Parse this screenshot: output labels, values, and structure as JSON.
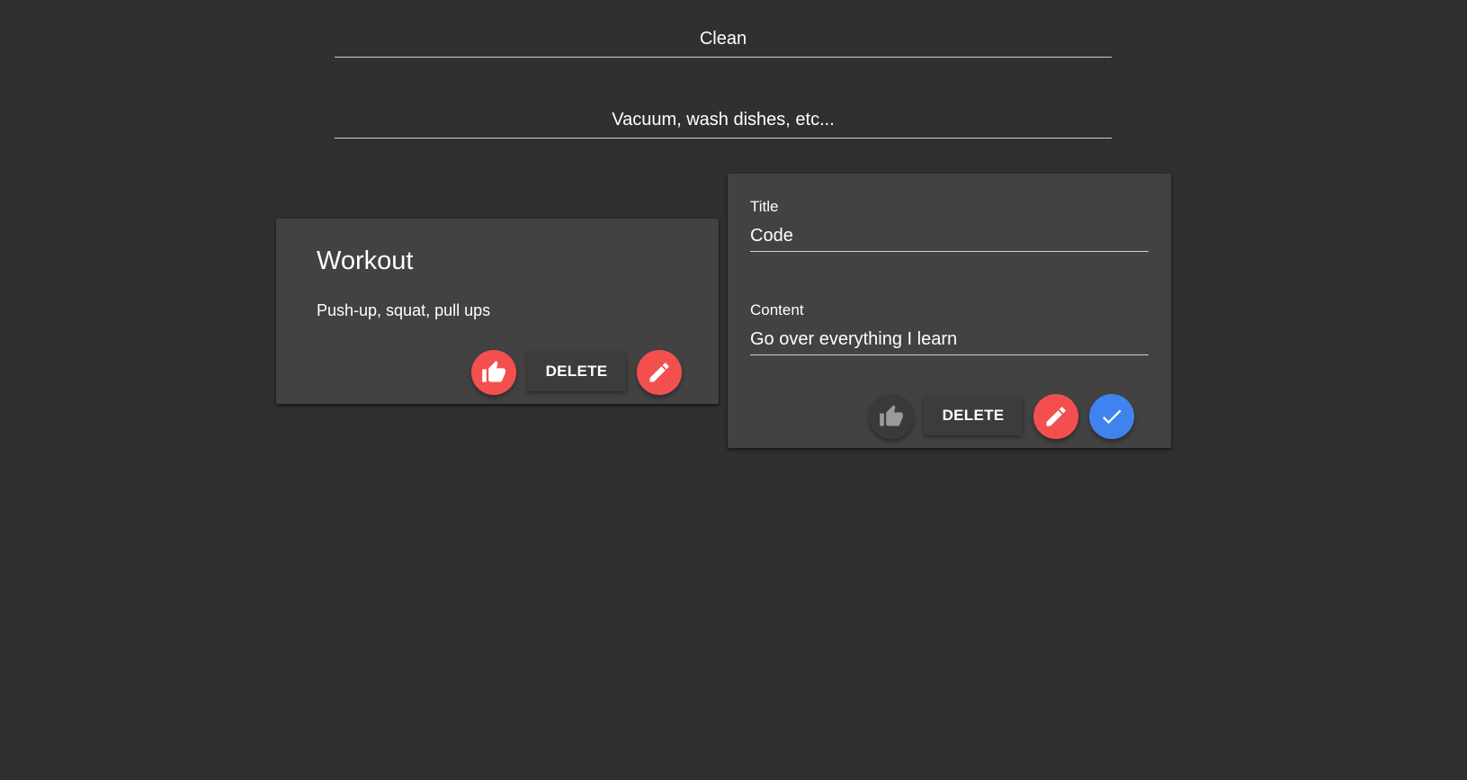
{
  "create_form": {
    "title_placeholder": "Clean",
    "content_placeholder": "Vacuum, wash dishes, etc..."
  },
  "notes": [
    {
      "title": "Workout",
      "content": "Push-up, squat, pull ups",
      "liked": true,
      "delete_label": "DELETE"
    },
    {
      "editing": true,
      "title_label": "Title",
      "title_value": "Code",
      "content_label": "Content",
      "content_value": "Go over everything I learn",
      "liked": false,
      "delete_label": "DELETE"
    }
  ],
  "colors": {
    "background": "#303030",
    "card": "#424242",
    "accent_red": "#f44f4f",
    "accent_blue": "#3f83f0"
  },
  "icons": {
    "like": "thumb-up-icon",
    "edit": "pencil-icon",
    "confirm": "check-icon"
  }
}
